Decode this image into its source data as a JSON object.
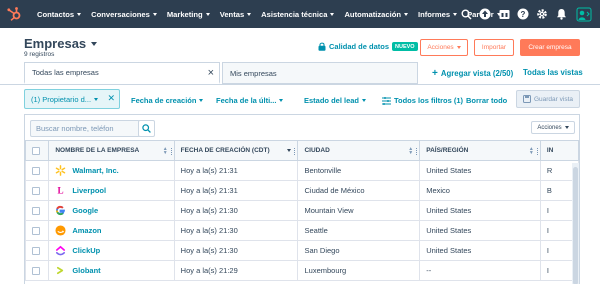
{
  "nav": {
    "items": [
      {
        "label": "Contactos"
      },
      {
        "label": "Conversaciones"
      },
      {
        "label": "Marketing"
      },
      {
        "label": "Ventas"
      },
      {
        "label": "Asistencia técnica"
      },
      {
        "label": "Automatización"
      },
      {
        "label": "Informes"
      },
      {
        "label": "Partner"
      }
    ],
    "icons": [
      "search-icon",
      "upgrade-icon",
      "marketplace-icon",
      "help-icon",
      "settings-icon",
      "notifications-icon",
      "avatar"
    ]
  },
  "header": {
    "title": "Empresas",
    "subtitle": "9 registros",
    "data_quality": "Calidad de datos",
    "badge": "NUEVO",
    "actions": "Acciones",
    "import": "Importar",
    "create": "Crear empresa"
  },
  "views": {
    "tabs": [
      "Todas las empresas",
      "Mis empresas"
    ],
    "add_view": "Agregar vista (2/50)",
    "all_views": "Todas las vistas"
  },
  "filters": {
    "owner_chip": "(1) Propietario d...",
    "created": "Fecha de creación",
    "last": "Fecha de la últi...",
    "lead_status": "Estado del lead",
    "all_filters": "Todos los filtros (1)",
    "clear": "Borrar todo",
    "save_view": "Guardar vista"
  },
  "table": {
    "search_placeholder": "Buscar nombre, teléfon",
    "actions": "Acciones",
    "columns": [
      "NOMBRE DE LA EMPRESA",
      "FECHA DE CREACIÓN (CDT)",
      "CIUDAD",
      "PAÍS/REGIÓN",
      "IN"
    ],
    "rows": [
      {
        "name": "Walmart, Inc.",
        "date": "Hoy a la(s) 21:31",
        "city": "Bentonville",
        "country": "United States",
        "extra": "R",
        "logo": "walmart-logo"
      },
      {
        "name": "Liverpool",
        "date": "Hoy a la(s) 21:31",
        "city": "Ciudad de México",
        "country": "Mexico",
        "extra": "B",
        "logo": "liverpool-logo"
      },
      {
        "name": "Google",
        "date": "Hoy a la(s) 21:30",
        "city": "Mountain View",
        "country": "United States",
        "extra": "I",
        "logo": "google-logo"
      },
      {
        "name": "Amazon",
        "date": "Hoy a la(s) 21:30",
        "city": "Seattle",
        "country": "United States",
        "extra": "I",
        "logo": "amazon-logo"
      },
      {
        "name": "ClickUp",
        "date": "Hoy a la(s) 21:30",
        "city": "San Diego",
        "country": "United States",
        "extra": "I",
        "logo": "clickup-logo"
      },
      {
        "name": "Globant",
        "date": "Hoy a la(s) 21:29",
        "city": "Luxembourg",
        "country": "--",
        "extra": "I",
        "logo": "globant-logo"
      }
    ]
  },
  "colors": {
    "nav_bg": "#2d3e50",
    "accent": "#ff7a59",
    "link": "#0091ae",
    "badge": "#00bda5"
  }
}
